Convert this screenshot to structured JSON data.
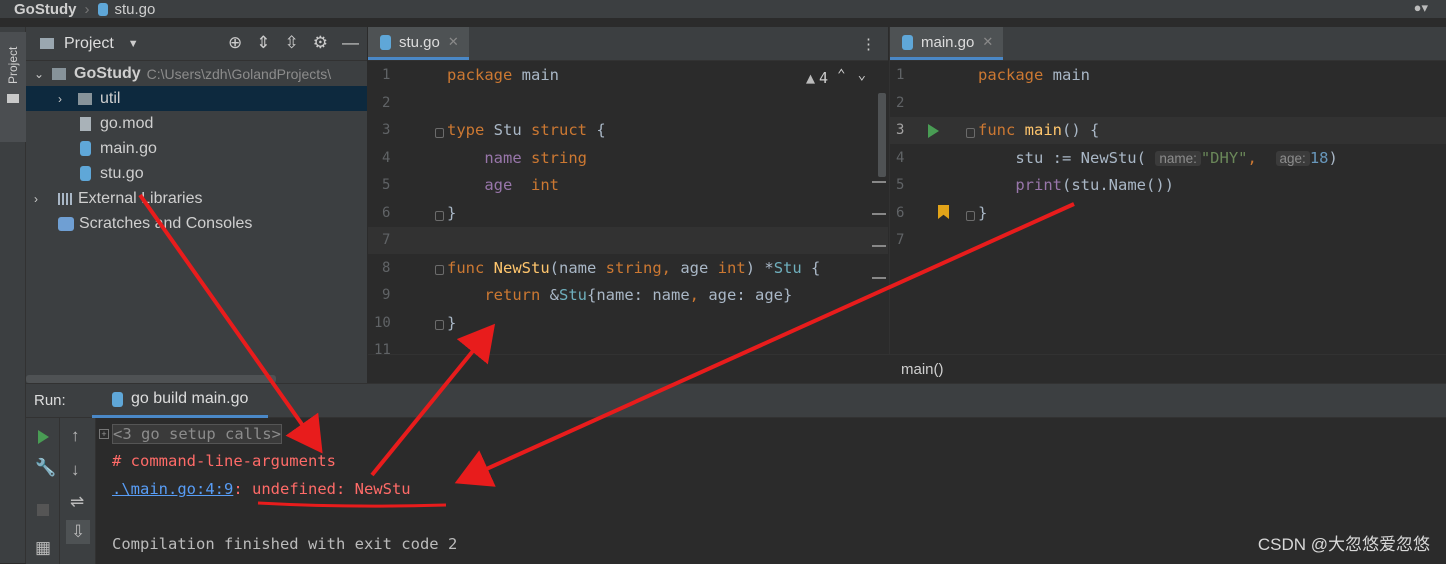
{
  "breadcrumb": {
    "root": "GoStudy",
    "file": "stu.go"
  },
  "toolstrip": {
    "project_tab": "Project"
  },
  "project": {
    "header_label": "Project",
    "tree": [
      {
        "label": "GoStudy",
        "path": "C:\\Users\\zdh\\GolandProjects\\",
        "kind": "folder"
      },
      {
        "label": "util",
        "kind": "folder"
      },
      {
        "label": "go.mod",
        "kind": "mod"
      },
      {
        "label": "main.go",
        "kind": "go"
      },
      {
        "label": "stu.go",
        "kind": "go"
      },
      {
        "label": "External Libraries",
        "kind": "lib"
      },
      {
        "label": "Scratches and Consoles",
        "kind": "scratch"
      }
    ]
  },
  "editor_left": {
    "tab": "stu.go",
    "warnings": "4",
    "line_numbers": [
      "1",
      "2",
      "3",
      "4",
      "5",
      "6",
      "7",
      "8",
      "9",
      "10",
      "11"
    ],
    "lines": [
      "package main",
      "",
      "type Stu struct {",
      "    name string",
      "    age  int",
      "}",
      "",
      "func NewStu(name string, age int) *Stu {",
      "    return &Stu{name: name, age: age}",
      "}"
    ]
  },
  "editor_right": {
    "tab": "main.go",
    "line_numbers": [
      "1",
      "2",
      "3",
      "4",
      "5",
      "6",
      "7"
    ],
    "hint_name": "name:",
    "hint_age": "age:",
    "string_val": "\"DHY\"",
    "num_val": "18"
  },
  "crumb": {
    "text": "main()"
  },
  "run": {
    "label": "Run:",
    "tab": "go build main.go",
    "output": {
      "collapsed": "<3 go setup calls>",
      "comment": "# command-line-arguments",
      "link": ".\\main.go:4:9",
      "error": ": undefined: NewStu",
      "blank": "",
      "finished": "Compilation finished with exit code 2"
    }
  },
  "watermark": "CSDN @大忽悠爱忽悠",
  "colors": {
    "accent": "#4a88c7",
    "annotation_red": "#e81c1c",
    "error_red": "#ff6b68",
    "link_blue": "#589df6"
  }
}
